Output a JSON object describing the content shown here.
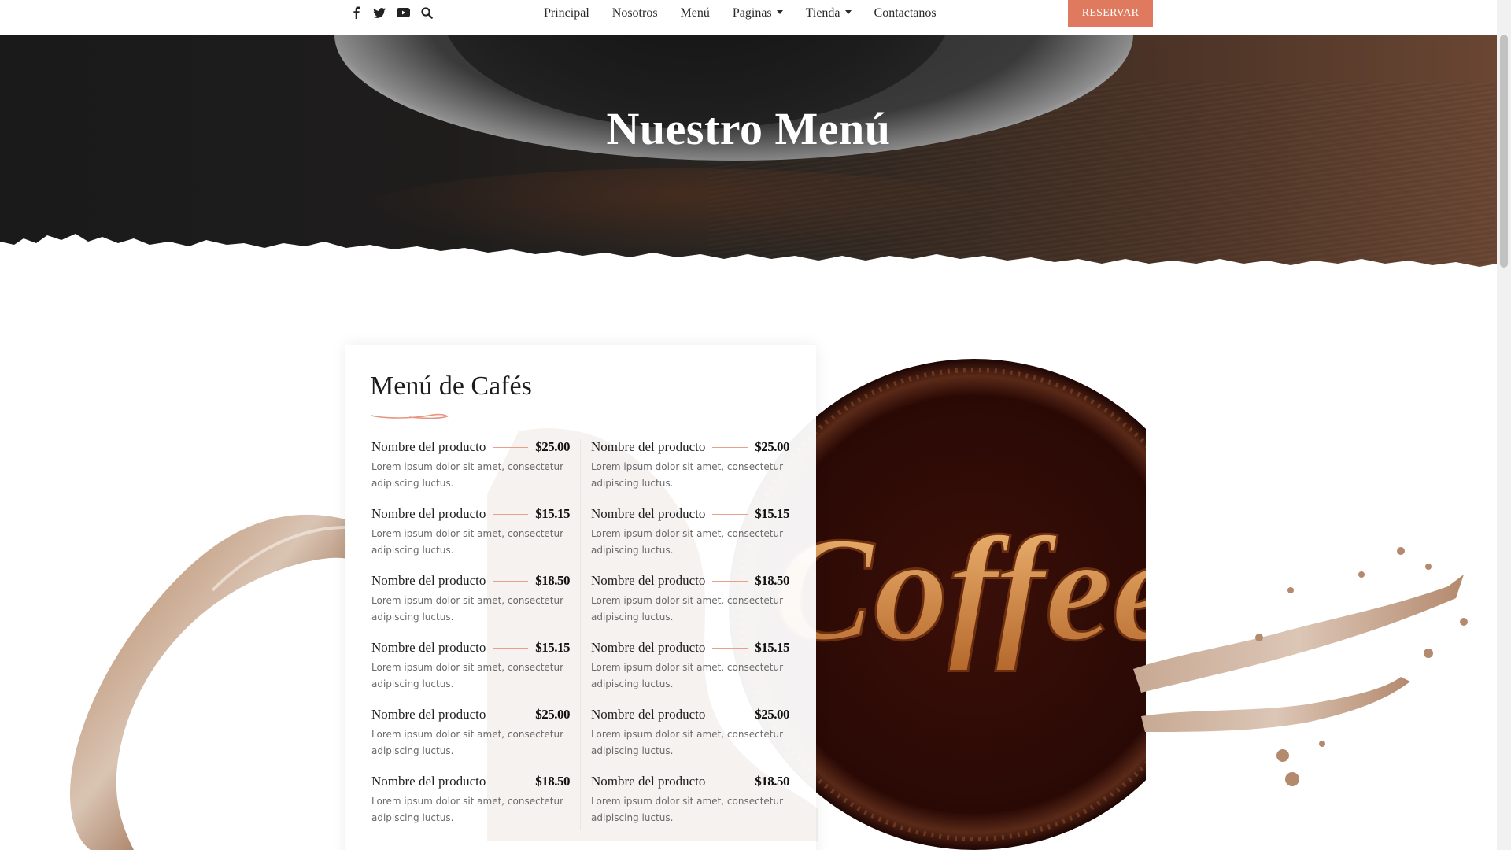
{
  "nav": {
    "social_icons": [
      "facebook-icon",
      "twitter-icon",
      "youtube-icon",
      "search-icon"
    ],
    "items": [
      {
        "label": "Principal",
        "dropdown": false
      },
      {
        "label": "Nosotros",
        "dropdown": false
      },
      {
        "label": "Menú",
        "dropdown": false
      },
      {
        "label": "Paginas",
        "dropdown": true
      },
      {
        "label": "Tienda",
        "dropdown": true
      },
      {
        "label": "Contactanos",
        "dropdown": false
      }
    ],
    "cta_label": "RESERVAR"
  },
  "hero": {
    "title": "Nuestro Menú"
  },
  "menu_card": {
    "title": "Menú de Cafés",
    "left": [
      {
        "name": "Nombre del producto",
        "price": "$25.00",
        "desc": "Lorem ipsum dolor sit amet, consectetur adipiscing luctus."
      },
      {
        "name": "Nombre del producto",
        "price": "$15.15",
        "desc": "Lorem ipsum dolor sit amet, consectetur adipiscing luctus."
      },
      {
        "name": "Nombre del producto",
        "price": "$18.50",
        "desc": "Lorem ipsum dolor sit amet, consectetur adipiscing luctus."
      },
      {
        "name": "Nombre del producto",
        "price": "$15.15",
        "desc": "Lorem ipsum dolor sit amet, consectetur adipiscing luctus."
      },
      {
        "name": "Nombre del producto",
        "price": "$25.00",
        "desc": "Lorem ipsum dolor sit amet, consectetur adipiscing luctus."
      },
      {
        "name": "Nombre del producto",
        "price": "$18.50",
        "desc": "Lorem ipsum dolor sit amet, consectetur adipiscing luctus."
      }
    ],
    "right": [
      {
        "name": "Nombre del producto",
        "price": "$25.00",
        "desc": "Lorem ipsum dolor sit amet, consectetur adipiscing luctus."
      },
      {
        "name": "Nombre del producto",
        "price": "$15.15",
        "desc": "Lorem ipsum dolor sit amet, consectetur adipiscing luctus."
      },
      {
        "name": "Nombre del producto",
        "price": "$18.50",
        "desc": "Lorem ipsum dolor sit amet, consectetur adipiscing luctus."
      },
      {
        "name": "Nombre del producto",
        "price": "$15.15",
        "desc": "Lorem ipsum dolor sit amet, consectetur adipiscing luctus."
      },
      {
        "name": "Nombre del producto",
        "price": "$25.00",
        "desc": "Lorem ipsum dolor sit amet, consectetur adipiscing luctus."
      },
      {
        "name": "Nombre del producto",
        "price": "$18.50",
        "desc": "Lorem ipsum dolor sit amet, consectetur adipiscing luctus."
      }
    ]
  },
  "decor": {
    "logo_text": "Coffee"
  },
  "colors": {
    "accent": "#e07a5f",
    "text": "#1f1f1f",
    "muted": "#6a6a6a"
  }
}
